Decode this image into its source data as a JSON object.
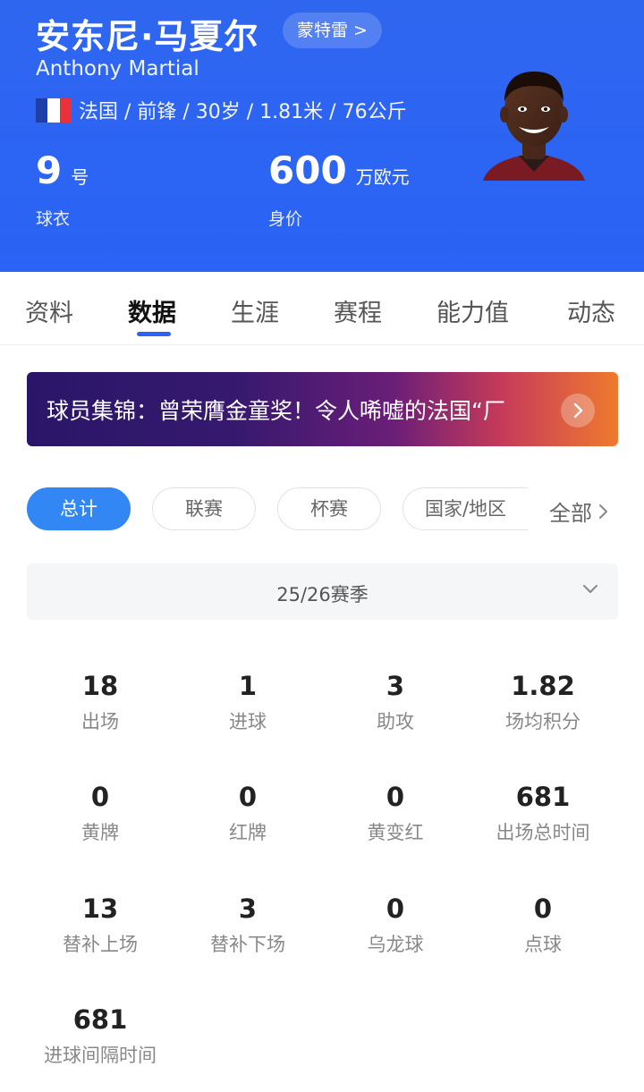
{
  "player": {
    "name_cn": "安东尼·马夏尔",
    "name_en": "Anthony Martial",
    "team_link": "蒙特雷 >",
    "info": "法国 / 前锋 / 30岁 / 1.81米 / 76公斤",
    "flag_colors": [
      "#1f3fa8",
      "#ffffff",
      "#e8313b"
    ],
    "shirt_number": "9",
    "shirt_unit": "号",
    "shirt_label": "球衣",
    "market_value": "600",
    "market_value_unit": "万欧元",
    "market_value_label": "身价"
  },
  "tabs": [
    "资料",
    "数据",
    "生涯",
    "赛程",
    "能力值",
    "动态"
  ],
  "active_tab": "数据",
  "banner": {
    "text": "球员集锦：曾荣膺金童奖！令人唏嘘的法国“厂",
    "arrow_icon": "chevron-right-icon"
  },
  "filters": {
    "chips": [
      "总计",
      "联赛",
      "杯赛",
      "国家/地区"
    ],
    "active": "总计",
    "all_label": "全部"
  },
  "season": {
    "label": "25/26赛季",
    "icon": "chevron-down-icon"
  },
  "stats": [
    {
      "value": "18",
      "label": "出场"
    },
    {
      "value": "1",
      "label": "进球"
    },
    {
      "value": "3",
      "label": "助攻"
    },
    {
      "value": "1.82",
      "label": "场均积分"
    },
    {
      "value": "0",
      "label": "黄牌"
    },
    {
      "value": "0",
      "label": "红牌"
    },
    {
      "value": "0",
      "label": "黄变红"
    },
    {
      "value": "681",
      "label": "出场总时间"
    },
    {
      "value": "13",
      "label": "替补上场"
    },
    {
      "value": "3",
      "label": "替补下场"
    },
    {
      "value": "0",
      "label": "乌龙球"
    },
    {
      "value": "0",
      "label": "点球"
    },
    {
      "value": "681",
      "label": "进球间隔时间"
    }
  ],
  "colors": {
    "header_blue": "#2a63f5",
    "accent_blue": "#3387f4",
    "banner_gradient": [
      "#2a1668",
      "#6a1e78",
      "#ef7a2e"
    ]
  }
}
